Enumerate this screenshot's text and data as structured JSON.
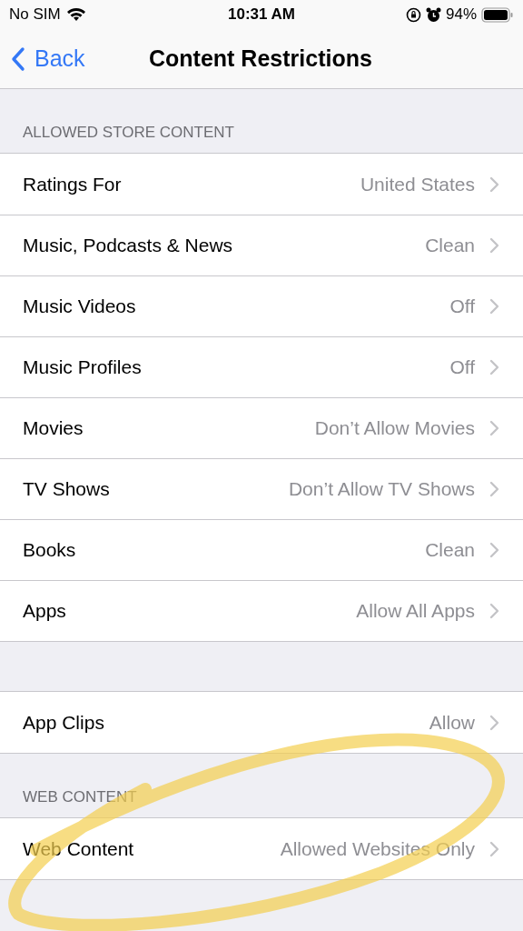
{
  "status_bar": {
    "carrier": "No SIM",
    "time": "10:31 AM",
    "battery": "94%"
  },
  "nav": {
    "back": "Back",
    "title": "Content Restrictions"
  },
  "sections": [
    {
      "header": "ALLOWED STORE CONTENT",
      "rows": [
        {
          "label": "Ratings For",
          "value": "United States"
        },
        {
          "label": "Music, Podcasts & News",
          "value": "Clean"
        },
        {
          "label": "Music Videos",
          "value": "Off"
        },
        {
          "label": "Music Profiles",
          "value": "Off"
        },
        {
          "label": "Movies",
          "value": "Don’t Allow Movies"
        },
        {
          "label": "TV Shows",
          "value": "Don’t Allow TV Shows"
        },
        {
          "label": "Books",
          "value": "Clean"
        },
        {
          "label": "Apps",
          "value": "Allow All Apps"
        }
      ]
    },
    {
      "rows": [
        {
          "label": "App Clips",
          "value": "Allow"
        }
      ]
    },
    {
      "header": "WEB CONTENT",
      "rows": [
        {
          "label": "Web Content",
          "value": "Allowed Websites Only"
        }
      ]
    }
  ]
}
